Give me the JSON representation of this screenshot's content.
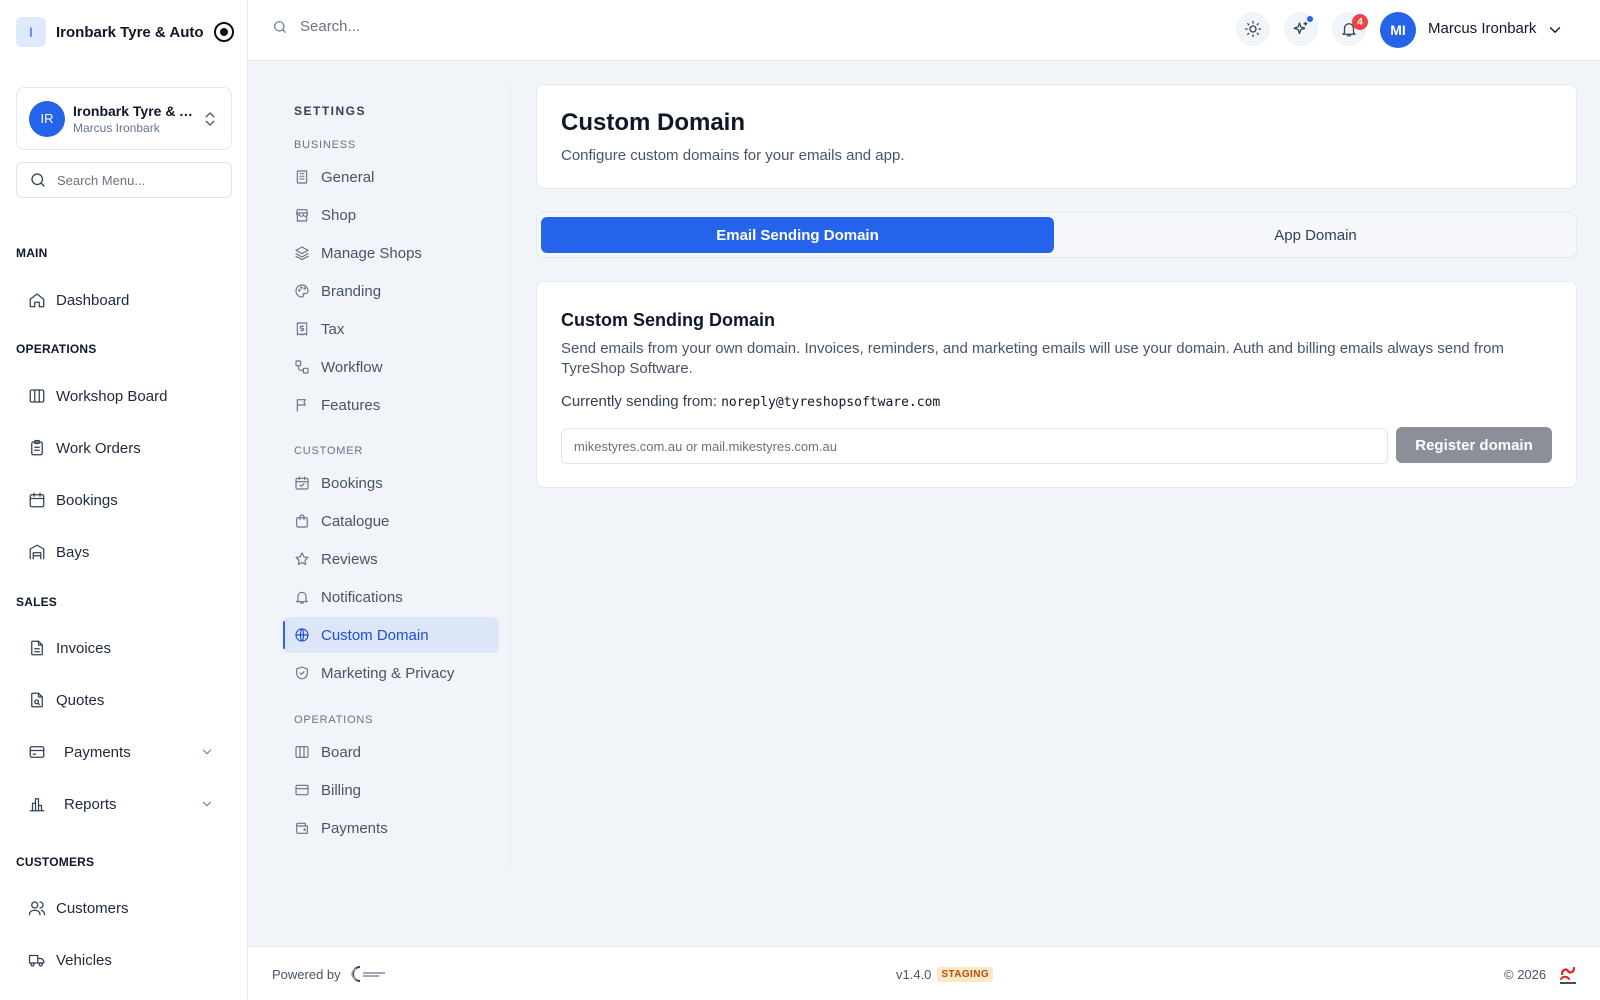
{
  "brand": {
    "logo_letter": "I",
    "name": "Ironbark Tyre & Auto"
  },
  "shop_switcher": {
    "initials": "IR",
    "name": "Ironbark Tyre & Auto",
    "owner": "Marcus Ironbark"
  },
  "menu_search": {
    "placeholder": "Search Menu..."
  },
  "sidebar": {
    "main": {
      "title": "MAIN",
      "dashboard": "Dashboard"
    },
    "operations": {
      "title": "OPERATIONS",
      "workshop_board": "Workshop Board",
      "work_orders": "Work Orders",
      "bookings": "Bookings",
      "bays": "Bays"
    },
    "sales": {
      "title": "SALES",
      "invoices": "Invoices",
      "quotes": "Quotes",
      "payments": "Payments",
      "reports": "Reports"
    },
    "customers": {
      "title": "CUSTOMERS",
      "customers": "Customers",
      "vehicles": "Vehicles"
    }
  },
  "topbar": {
    "search_placeholder": "Search...",
    "notifications_count": "4",
    "user_initials": "MI",
    "user_name": "Marcus Ironbark"
  },
  "settings_nav": {
    "title": "SETTINGS",
    "business": {
      "title": "BUSINESS",
      "general": "General",
      "shop": "Shop",
      "manage_shops": "Manage Shops",
      "branding": "Branding",
      "tax": "Tax",
      "workflow": "Workflow",
      "features": "Features"
    },
    "customer": {
      "title": "CUSTOMER",
      "bookings": "Bookings",
      "catalogue": "Catalogue",
      "reviews": "Reviews",
      "notifications": "Notifications",
      "custom_domain": "Custom Domain",
      "marketing_privacy": "Marketing & Privacy"
    },
    "operations": {
      "title": "OPERATIONS",
      "board": "Board",
      "billing": "Billing",
      "payments": "Payments"
    },
    "active": "Custom Domain"
  },
  "page": {
    "title": "Custom Domain",
    "subtitle": "Configure custom domains for your emails and app.",
    "tabs": {
      "email": "Email Sending Domain",
      "app": "App Domain",
      "active": "Email Sending Domain"
    },
    "sending_card": {
      "title": "Custom Sending Domain",
      "description": "Send emails from your own domain. Invoices, reminders, and marketing emails will use your domain. Auth and billing emails always send from TyreShop Software.",
      "current_label": "Currently sending from:",
      "current_address": "noreply@tyreshopsoftware.com",
      "input_placeholder": "mikestyres.com.au or mail.mikestyres.com.au",
      "input_value": "",
      "button_label": "Register domain"
    }
  },
  "footer": {
    "powered_by": "Powered by",
    "version": "v1.4.0",
    "environment": "STAGING",
    "copyright": "© 2026"
  },
  "colors": {
    "accent": "#2563eb",
    "active_nav_bg": "#dce6f7",
    "notification_badge": "#ef4444",
    "disabled_button": "#8a8f98",
    "staging_badge_bg": "#fde7c7",
    "staging_badge_text": "#b45309"
  },
  "icons": {
    "sidebar": [
      "home-icon",
      "columns-icon",
      "clipboard-icon",
      "calendar-icon",
      "warehouse-icon",
      "file-text-icon",
      "file-search-icon",
      "credit-card-icon",
      "bar-chart-icon",
      "users-icon",
      "truck-icon"
    ],
    "settings": [
      "building-icon",
      "store-icon",
      "layers-icon",
      "palette-icon",
      "receipt-icon",
      "workflow-icon",
      "flag-icon",
      "calendar-check-icon",
      "shopping-bag-icon",
      "star-icon",
      "bell-icon",
      "globe-icon",
      "shield-check-icon",
      "columns-icon",
      "credit-card-icon",
      "wallet-icon"
    ]
  }
}
